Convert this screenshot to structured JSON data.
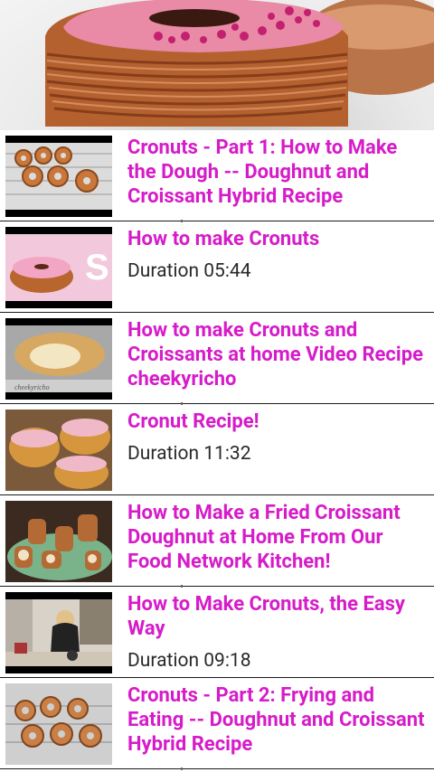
{
  "hero": {
    "image": "cronut-hero-photo"
  },
  "videos": [
    {
      "title": "Cronuts - Part 1: How to Make the Dough -- Doughnut and Croissant Hybrid Recipe",
      "duration": ""
    },
    {
      "title": "How to make Cronuts",
      "duration": "Duration 05:44"
    },
    {
      "title": "How to make Cronuts and Croissants at home Video Recipe cheekyricho",
      "duration": ""
    },
    {
      "title": "Cronut Recipe!",
      "duration": "Duration 11:32"
    },
    {
      "title": "How to Make a Fried Croissant Doughnut at Home From Our Food Network Kitchen!",
      "duration": ""
    },
    {
      "title": "How to Make Cronuts, the Easy Way",
      "duration": "Duration 09:18"
    },
    {
      "title": "Cronuts - Part 2: Frying and Eating -- Doughnut and Croissant Hybrid Recipe",
      "duration": ""
    }
  ],
  "colors": {
    "title": "#d61cc9",
    "duration": "#2a2a2a",
    "divider": "#1a1a1a"
  }
}
